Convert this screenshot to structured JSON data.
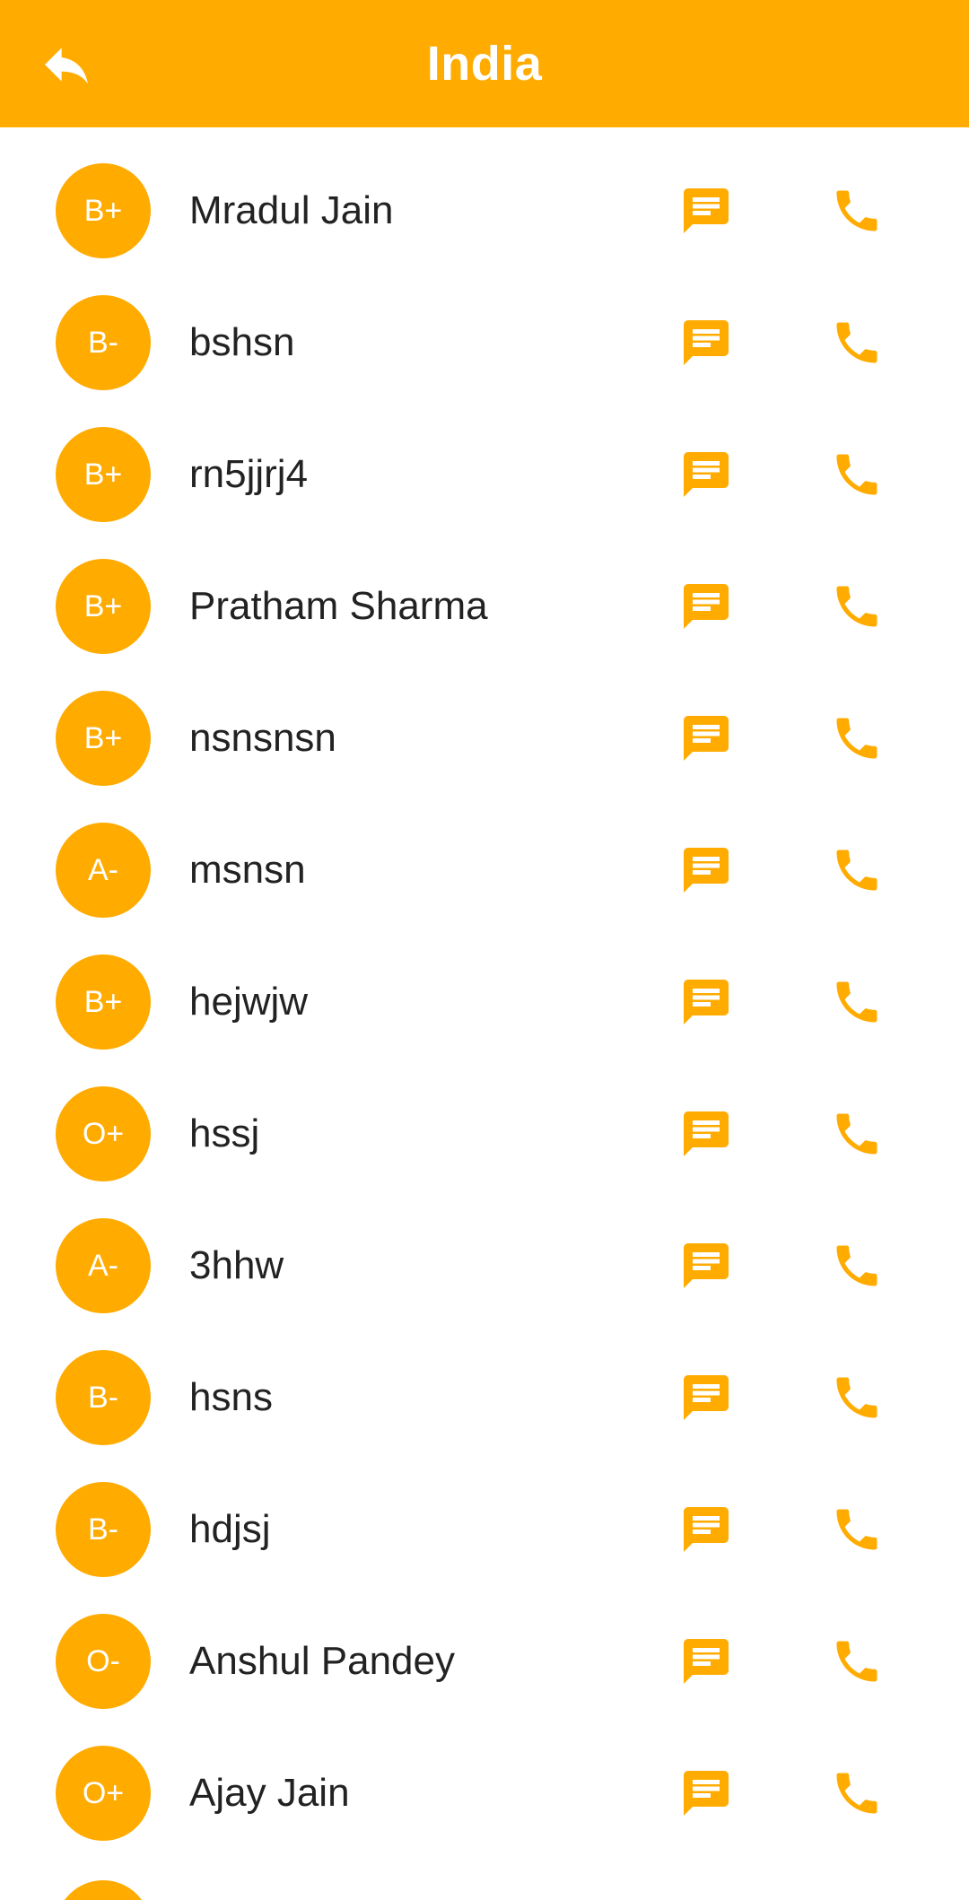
{
  "header": {
    "title": "India",
    "back_icon": "reply-arrow-icon",
    "background_color": "#ffab00"
  },
  "icons": {
    "message": "message-icon",
    "call": "phone-icon",
    "accent_color": "#ffab00"
  },
  "donors": [
    {
      "blood_group": "B+",
      "name": "Mradul Jain"
    },
    {
      "blood_group": "B-",
      "name": "bshsn"
    },
    {
      "blood_group": "B+",
      "name": "rn5jjrj4"
    },
    {
      "blood_group": "B+",
      "name": "Pratham Sharma"
    },
    {
      "blood_group": "B+",
      "name": "nsnsnsn"
    },
    {
      "blood_group": "A-",
      "name": "msnsn"
    },
    {
      "blood_group": "B+",
      "name": "hejwjw"
    },
    {
      "blood_group": "O+",
      "name": "hssj"
    },
    {
      "blood_group": "A-",
      "name": "3hhw"
    },
    {
      "blood_group": "B-",
      "name": "hsns"
    },
    {
      "blood_group": "B-",
      "name": "hdjsj"
    },
    {
      "blood_group": "O-",
      "name": "Anshul Pandey"
    },
    {
      "blood_group": "O+",
      "name": "Ajay Jain"
    }
  ]
}
